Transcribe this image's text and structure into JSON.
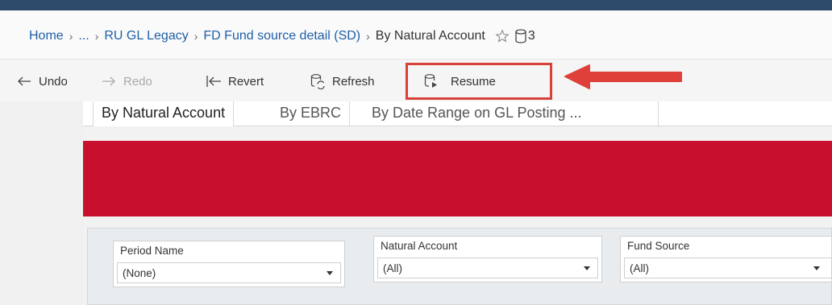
{
  "breadcrumb": {
    "items": [
      "Home",
      "...",
      "RU GL Legacy",
      "FD Fund source detail (SD)"
    ],
    "current": "By Natural Account",
    "separator": "›",
    "datasource_count": "3"
  },
  "toolbar": {
    "undo": "Undo",
    "redo": "Redo",
    "revert": "Revert",
    "refresh": "Refresh",
    "resume": "Resume"
  },
  "tabs": [
    "By Natural Account",
    "By EBRC",
    "By Date Range on GL Posting ..."
  ],
  "filters": [
    {
      "label": "Period Name",
      "value": "(None)"
    },
    {
      "label": "Natural Account",
      "value": "(All)"
    },
    {
      "label": "Fund Source",
      "value": "(All)"
    }
  ],
  "colors": {
    "banner": "#c8102e",
    "highlight": "#d8403a",
    "link": "#1f5fa8",
    "topbar": "#2e4a6b"
  }
}
